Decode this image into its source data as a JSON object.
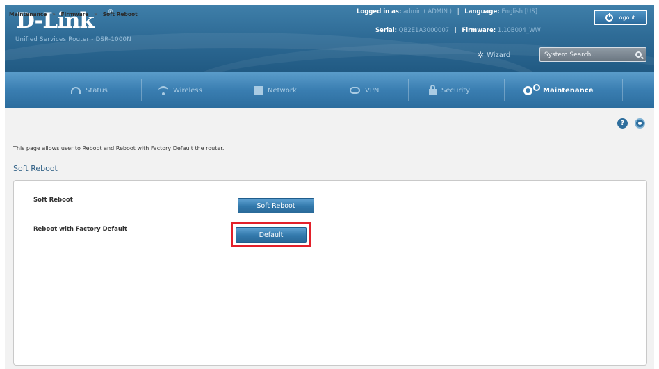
{
  "header": {
    "logo": "D-Link",
    "logo_mark": "®",
    "subtitle": "Unified Services Router - DSR-1000N",
    "logged_in_label": "Logged in as:",
    "logged_in_value": "admin ( ADMIN )",
    "language_label": "Language:",
    "language_value": "English [US]",
    "serial_label": "Serial:",
    "serial_value": "QB2E1A3000007",
    "firmware_label": "Firmware:",
    "firmware_value": "1.10B004_WW",
    "logout_label": "Logout",
    "wizard_label": "Wizard",
    "search_placeholder": "System Search..."
  },
  "nav": {
    "items": [
      {
        "label": "Status",
        "icon": "status-gauge-icon"
      },
      {
        "label": "Wireless",
        "icon": "wifi-icon"
      },
      {
        "label": "Network",
        "icon": "network-icon"
      },
      {
        "label": "VPN",
        "icon": "cloud-icon"
      },
      {
        "label": "Security",
        "icon": "lock-icon"
      },
      {
        "label": "Maintenance",
        "icon": "gear-icon",
        "active": true
      }
    ]
  },
  "breadcrumb": {
    "items": [
      "Maintenance",
      "Firmware",
      "Soft Reboot"
    ],
    "separator": "»"
  },
  "page": {
    "description": "This page allows user to Reboot and Reboot with Factory Default the router.",
    "section_title": "Soft Reboot",
    "rows": [
      {
        "label": "Soft Reboot",
        "button": "Soft Reboot"
      },
      {
        "label": "Reboot with Factory Default",
        "button": "Default"
      }
    ]
  },
  "colors": {
    "header_blue": "#2f6c97",
    "button_blue": "#3278ab",
    "highlight_red": "#e3202a"
  }
}
